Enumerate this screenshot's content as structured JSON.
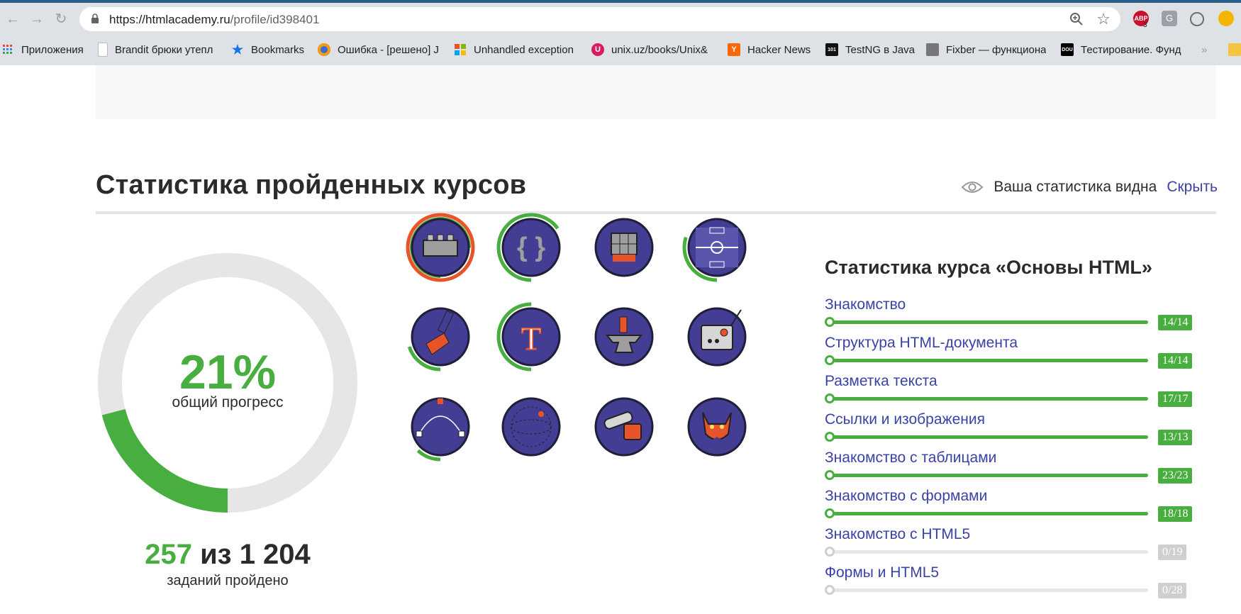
{
  "browser": {
    "url_host": "https://htmlacademy.ru",
    "url_path": "/profile/id398401",
    "abp_count": "3",
    "bookmarks": [
      {
        "label": "Приложения",
        "icon": "apps-grid-icon",
        "color": "#e8453c"
      },
      {
        "label": "Brandit брюки утепл",
        "icon": "document-icon",
        "color": "#9aa0a6"
      },
      {
        "label": "Bookmarks",
        "icon": "star-icon",
        "color": "#1a73e8"
      },
      {
        "label": "Ошибка - [решено] J",
        "icon": "firefox-icon",
        "color": "#3b6bd6"
      },
      {
        "label": "Unhandled exception",
        "icon": "windows-logo-icon",
        "color": "#f25022"
      },
      {
        "label": "unix.uz/books/Unix&",
        "icon": "u-logo-icon",
        "color": "#d81b60"
      },
      {
        "label": "Hacker News",
        "icon": "hacker-news-icon",
        "color": "#ff6600"
      },
      {
        "label": "TestNG в Java",
        "icon": "binary-icon",
        "color": "#111111"
      },
      {
        "label": "Fixber — функциона",
        "icon": "fixber-icon",
        "color": "#777777"
      },
      {
        "label": "Тестирование. Фунд",
        "icon": "dou-icon",
        "color": "#000000"
      }
    ],
    "apps_label": "Приложения"
  },
  "page": {
    "heading": "Статистика пройденных курсов",
    "visibility_text": "Ваша статистика видна",
    "hide_link": "Скрыть",
    "progress_percent": "21%",
    "progress_value": 0.21,
    "progress_label": "общий прогресс",
    "tasks_done": "257",
    "tasks_sep": "из",
    "tasks_total": "1 204",
    "tasks_label": "заданий пройдено"
  },
  "colors": {
    "accent_green": "#48ae3f",
    "link_blue": "#3a42a8",
    "badge_blue": "#433e94",
    "ring_orange": "#e8542a",
    "track_gray": "#e6e6e6",
    "inactive_gray": "#cfcfcf"
  },
  "badges": [
    {
      "name": "lego-brick-badge",
      "ring": "orange",
      "progress": 0.9
    },
    {
      "name": "curly-braces-badge",
      "ring": "green",
      "progress": 0.65
    },
    {
      "name": "rubiks-cube-badge",
      "ring": "none",
      "progress": 0
    },
    {
      "name": "football-field-badge",
      "ring": "green",
      "progress": 0.3
    },
    {
      "name": "paint-brush-badge",
      "ring": "green",
      "progress": 0.2
    },
    {
      "name": "typography-t-badge",
      "ring": "green",
      "progress": 0.5
    },
    {
      "name": "anvil-badge",
      "ring": "none",
      "progress": 0
    },
    {
      "name": "robot-remote-badge",
      "ring": "none",
      "progress": 0
    },
    {
      "name": "bezier-curve-badge",
      "ring": "green",
      "progress": 0.12
    },
    {
      "name": "sphere-wireframe-badge",
      "ring": "none",
      "progress": 0
    },
    {
      "name": "chainsaw-badge",
      "ring": "none",
      "progress": 0
    },
    {
      "name": "cat-gentleman-badge",
      "ring": "none",
      "progress": 0
    }
  ],
  "course": {
    "title": "Статистика курса «Основы HTML»",
    "lessons": [
      {
        "name": "Знакомство",
        "score": "14/14",
        "done": 14,
        "total": 14
      },
      {
        "name": "Структура HTML-документа",
        "score": "14/14",
        "done": 14,
        "total": 14
      },
      {
        "name": "Разметка текста",
        "score": "17/17",
        "done": 17,
        "total": 17
      },
      {
        "name": "Ссылки и изображения",
        "score": "13/13",
        "done": 13,
        "total": 13
      },
      {
        "name": "Знакомство с таблицами",
        "score": "23/23",
        "done": 23,
        "total": 23
      },
      {
        "name": "Знакомство с формами",
        "score": "18/18",
        "done": 18,
        "total": 18
      },
      {
        "name": "Знакомство с HTML5",
        "score": "0/19",
        "done": 0,
        "total": 19
      },
      {
        "name": "Формы и HTML5",
        "score": "0/28",
        "done": 0,
        "total": 28
      }
    ]
  }
}
